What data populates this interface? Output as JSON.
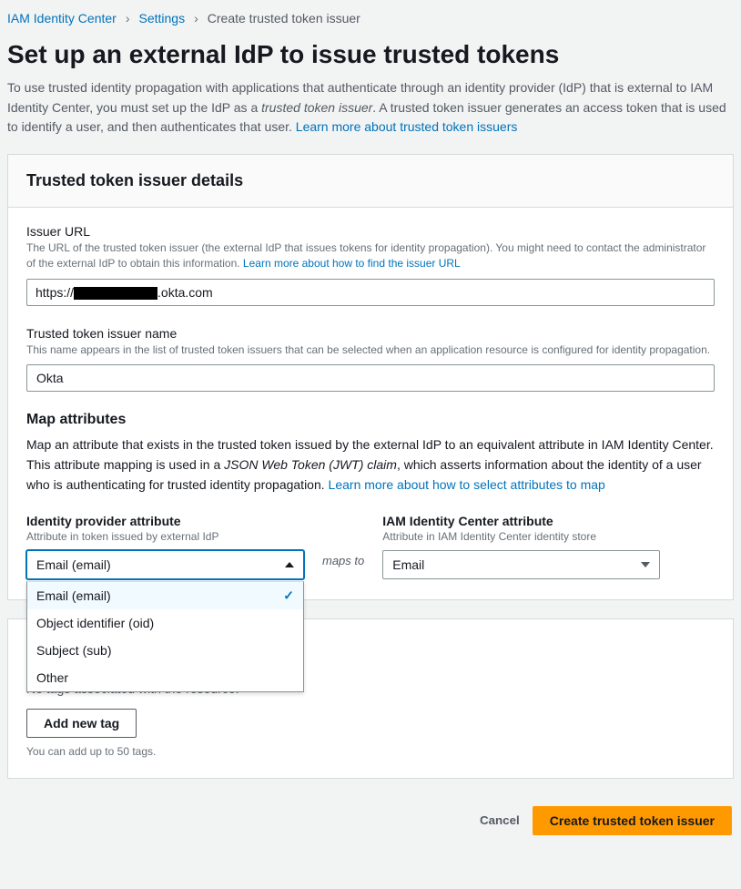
{
  "breadcrumb": {
    "items": [
      {
        "label": "IAM Identity Center",
        "link": true
      },
      {
        "label": "Settings",
        "link": true
      },
      {
        "label": "Create trusted token issuer",
        "link": false
      }
    ]
  },
  "page": {
    "title": "Set up an external IdP to issue trusted tokens",
    "desc_pre": "To use trusted identity propagation with applications that authenticate through an identity provider (IdP) that is external to IAM Identity Center, you must set up the IdP as a ",
    "desc_em": "trusted token issuer",
    "desc_post": ". A trusted token issuer generates an access token that is used to identify a user, and then authenticates that user. ",
    "desc_link": "Learn more about trusted token issuers"
  },
  "panel1": {
    "title": "Trusted token issuer details",
    "issuer_url": {
      "label": "Issuer URL",
      "hint": "The URL of the trusted token issuer (the external IdP that issues tokens for identity propagation). You might need to contact the administrator of the external IdP to obtain this information. ",
      "hint_link": "Learn more about how to find the issuer URL",
      "value_prefix": "https://",
      "value_suffix": ".okta.com"
    },
    "issuer_name": {
      "label": "Trusted token issuer name",
      "hint": "This name appears in the list of trusted token issuers that can be selected when an application resource is configured for identity propagation.",
      "value": "Okta"
    },
    "map": {
      "title": "Map attributes",
      "desc_pre": "Map an attribute that exists in the trusted token issued by the external IdP to an equivalent attribute in IAM Identity Center. This attribute mapping is used in a ",
      "desc_em": "JSON Web Token (JWT) claim",
      "desc_post": ", which asserts information about the identity of a user who is authenticating for trusted identity propagation. ",
      "desc_link": "Learn more about how to select attributes to map",
      "left_head": "Identity provider attribute",
      "left_sub": "Attribute in token issued by external IdP",
      "maps_to": "maps to",
      "right_head": "IAM Identity Center attribute",
      "right_sub": "Attribute in IAM Identity Center identity store",
      "left_selected": "Email (email)",
      "right_selected": "Email",
      "left_options": [
        "Email (email)",
        "Object identifier (oid)",
        "Subject (sub)",
        "Other"
      ]
    }
  },
  "tags": {
    "none": "No tags associated with the resource.",
    "add": "Add new tag",
    "limit": "You can add up to 50 tags."
  },
  "footer": {
    "cancel": "Cancel",
    "create": "Create trusted token issuer"
  }
}
